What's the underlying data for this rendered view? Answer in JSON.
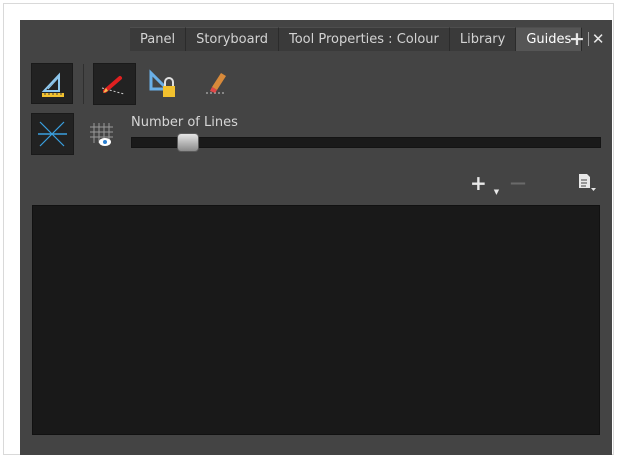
{
  "tabs": [
    {
      "label": "Panel",
      "active": false
    },
    {
      "label": "Storyboard",
      "active": false
    },
    {
      "label": "Tool Properties : Colour",
      "active": false
    },
    {
      "label": "Library",
      "active": false
    },
    {
      "label": "Guides",
      "active": true
    }
  ],
  "tab_actions": {
    "add_glyph": "+",
    "close_glyph": "✕"
  },
  "tools": [
    {
      "icon": "ruler-triangle-icon",
      "selected": true
    },
    {
      "icon": "guide-pen-icon",
      "selected": true
    },
    {
      "icon": "lock-guide-icon",
      "selected": false
    },
    {
      "icon": "guide-eraser-icon",
      "selected": false
    },
    {
      "icon": "vanishing-point-icon",
      "selected": true
    },
    {
      "icon": "grid-visibility-icon",
      "selected": false
    }
  ],
  "lines_slider": {
    "label": "Number of Lines",
    "position": 0.12
  },
  "list_actions": {
    "add_glyph": "+",
    "remove_glyph": "—",
    "menu_icon": "list-menu-icon"
  },
  "colors": {
    "panel": "#444444",
    "list": "#191919",
    "active_tab": "#565656"
  }
}
